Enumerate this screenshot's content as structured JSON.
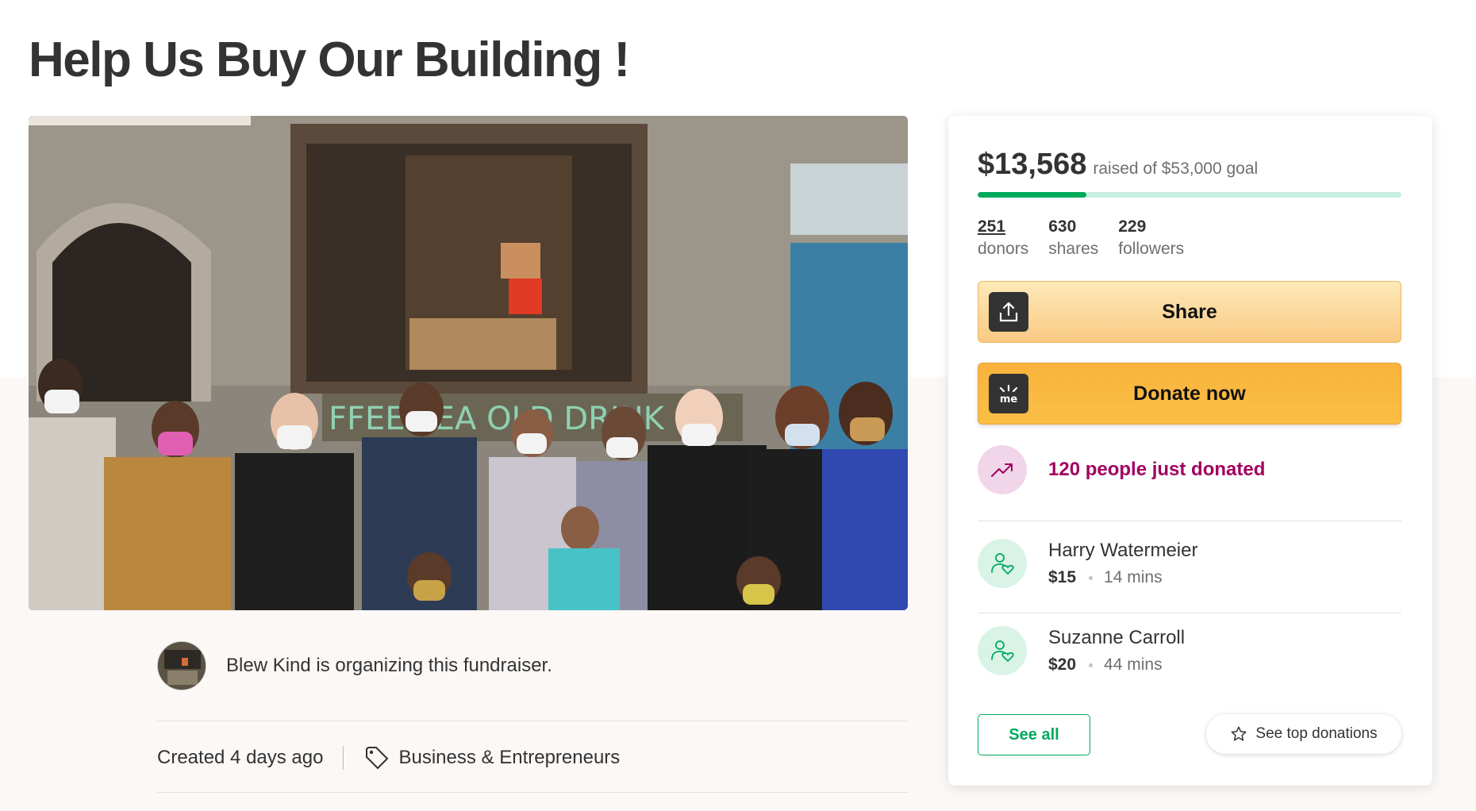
{
  "page": {
    "title": "Help Us Buy Our Building !"
  },
  "organizer": {
    "text": "Blew Kind is organizing this fundraiser."
  },
  "meta": {
    "created": "Created 4 days ago",
    "category": "Business & Entrepreneurs"
  },
  "campaign": {
    "raised": "$13,568",
    "goal_text": "raised of $53,000 goal",
    "progress_fraction": 0.256,
    "stats": [
      {
        "value": "251",
        "label": "donors"
      },
      {
        "value": "630",
        "label": "shares"
      },
      {
        "value": "229",
        "label": "followers"
      }
    ],
    "share_label": "Share",
    "donate_label": "Donate now",
    "donate_logo": "me",
    "trend_text": "120 people just donated",
    "donations": [
      {
        "name": "Harry Watermeier",
        "amount": "$15",
        "time": "14 mins"
      },
      {
        "name": "Suzanne Carroll",
        "amount": "$20",
        "time": "44 mins"
      }
    ],
    "see_all_label": "See all",
    "see_top_label": "See top donations"
  },
  "colors": {
    "accent_green": "#02a95c",
    "trend_purple": "#a10060",
    "donate_orange": "#f8b33c"
  },
  "icons": {
    "share": "share-upload-icon",
    "donate": "gofundme-logo-icon",
    "trend": "trending-up-icon",
    "donor": "donor-heart-icon",
    "tag": "tag-icon",
    "star": "star-icon"
  }
}
